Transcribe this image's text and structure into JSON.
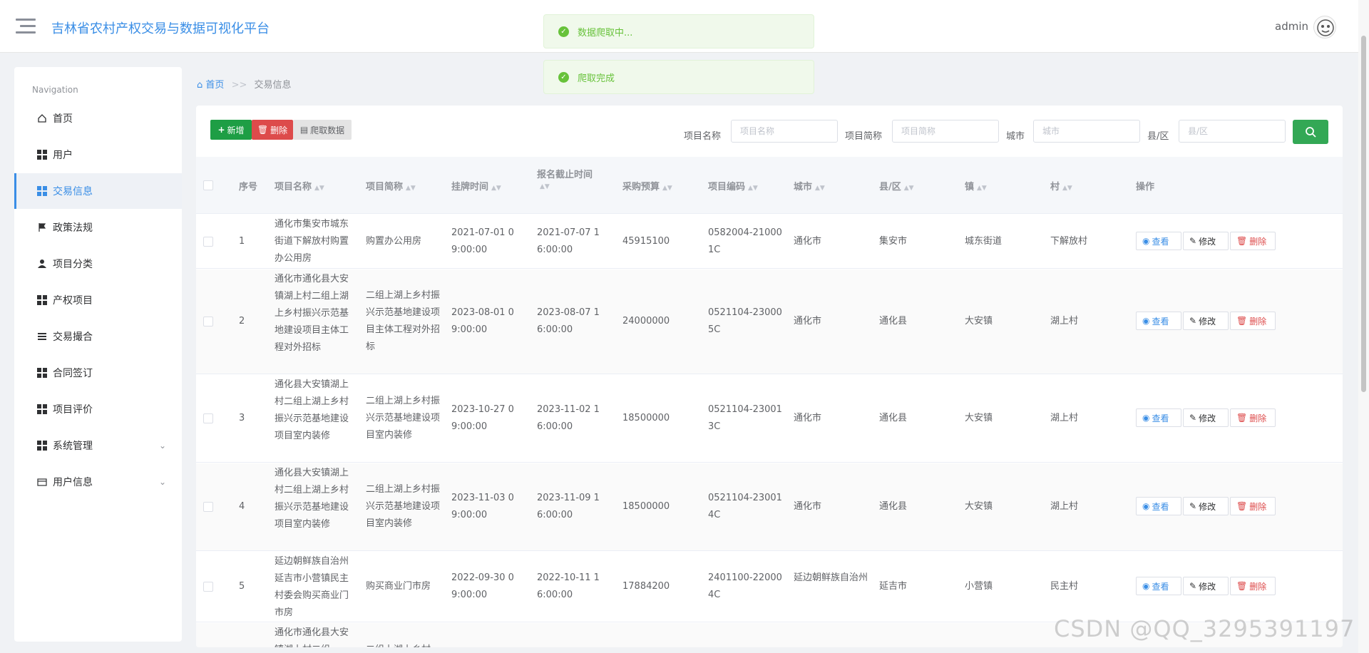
{
  "header": {
    "title": "吉林省农村产权交易与数据可视化平台",
    "user": "admin"
  },
  "messages": [
    "数据爬取中...",
    "爬取完成"
  ],
  "sidebar": {
    "caption": "Navigation",
    "items": [
      {
        "label": "首页",
        "icon": "home-icon"
      },
      {
        "label": "用户",
        "icon": "grid-icon"
      },
      {
        "label": "交易信息",
        "icon": "grid-icon"
      },
      {
        "label": "政策法规",
        "icon": "flag-icon"
      },
      {
        "label": "项目分类",
        "icon": "person-icon"
      },
      {
        "label": "产权项目",
        "icon": "grid-icon"
      },
      {
        "label": "交易撮合",
        "icon": "list-icon"
      },
      {
        "label": "合同签订",
        "icon": "grid-icon"
      },
      {
        "label": "项目评价",
        "icon": "grid-icon"
      },
      {
        "label": "系统管理",
        "icon": "grid-icon"
      },
      {
        "label": "用户信息",
        "icon": "card-icon"
      }
    ]
  },
  "breadcrumb": {
    "home": "首页",
    "sep": ">>",
    "current": "交易信息"
  },
  "toolbar": {
    "add": "新增",
    "delete": "删除",
    "crawl": "爬取数据"
  },
  "filters": {
    "project_name": {
      "label": "项目名称",
      "placeholder": "项目名称"
    },
    "project_short": {
      "label": "项目简称",
      "placeholder": "项目简称"
    },
    "city": {
      "label": "城市",
      "placeholder": "城市"
    },
    "county": {
      "label": "县/区",
      "placeholder": "县/区"
    }
  },
  "table": {
    "headers": [
      "序号",
      "项目名称",
      "项目简称",
      "挂牌时间",
      "报名截止时间",
      "采购预算",
      "项目编码",
      "城市",
      "县/区",
      "镇",
      "村",
      "操作"
    ],
    "ops": {
      "view": "查看",
      "edit": "修改",
      "delete": "删除"
    },
    "rows": [
      {
        "no": "1",
        "name": "通化市集安市城东街道下解放村购置办公用房",
        "short": "购置办公用房",
        "list_time": "2021-07-01 09:00:00",
        "deadline": "2021-07-07 16:00:00",
        "budget": "45915100",
        "code": "0582004-210001C",
        "city": "通化市",
        "county": "集安市",
        "town": "城东街道",
        "village": "下解放村"
      },
      {
        "no": "2",
        "name": "通化市通化县大安镇湖上村二组上湖上乡村振兴示范基地建设项目主体工程对外招标",
        "short": "二组上湖上乡村振兴示范基地建设项目主体工程对外招标",
        "list_time": "2023-08-01 09:00:00",
        "deadline": "2023-08-07 16:00:00",
        "budget": "24000000",
        "code": "0521104-230005C",
        "city": "通化市",
        "county": "通化县",
        "town": "大安镇",
        "village": "湖上村"
      },
      {
        "no": "3",
        "name": "通化县大安镇湖上村二组上湖上乡村振兴示范基地建设项目室内装修",
        "short": "二组上湖上乡村振兴示范基地建设项目室内装修",
        "list_time": "2023-10-27 09:00:00",
        "deadline": "2023-11-02 16:00:00",
        "budget": "18500000",
        "code": "0521104-230013C",
        "city": "通化市",
        "county": "通化县",
        "town": "大安镇",
        "village": "湖上村"
      },
      {
        "no": "4",
        "name": "通化县大安镇湖上村二组上湖上乡村振兴示范基地建设项目室内装修",
        "short": "二组上湖上乡村振兴示范基地建设项目室内装修",
        "list_time": "2023-11-03 09:00:00",
        "deadline": "2023-11-09 16:00:00",
        "budget": "18500000",
        "code": "0521104-230014C",
        "city": "通化市",
        "county": "通化县",
        "town": "大安镇",
        "village": "湖上村"
      },
      {
        "no": "5",
        "name": "延边朝鲜族自治州延吉市小营镇民主村委会购买商业门市房",
        "short": "购买商业门市房",
        "list_time": "2022-09-30 09:00:00",
        "deadline": "2022-10-11 16:00:00",
        "budget": "17884200",
        "code": "2401100-220004C",
        "city": "延边朝鲜族自治州",
        "county": "延吉市",
        "town": "小营镇",
        "village": "民主村"
      },
      {
        "no": "",
        "name": "通化市通化县大安镇湖上村二组",
        "short": "二组上湖上乡村",
        "list_time": "",
        "deadline": "",
        "budget": "",
        "code": "",
        "city": "",
        "county": "",
        "town": "",
        "village": ""
      }
    ]
  },
  "watermark": "CSDN @QQ_3295391197"
}
